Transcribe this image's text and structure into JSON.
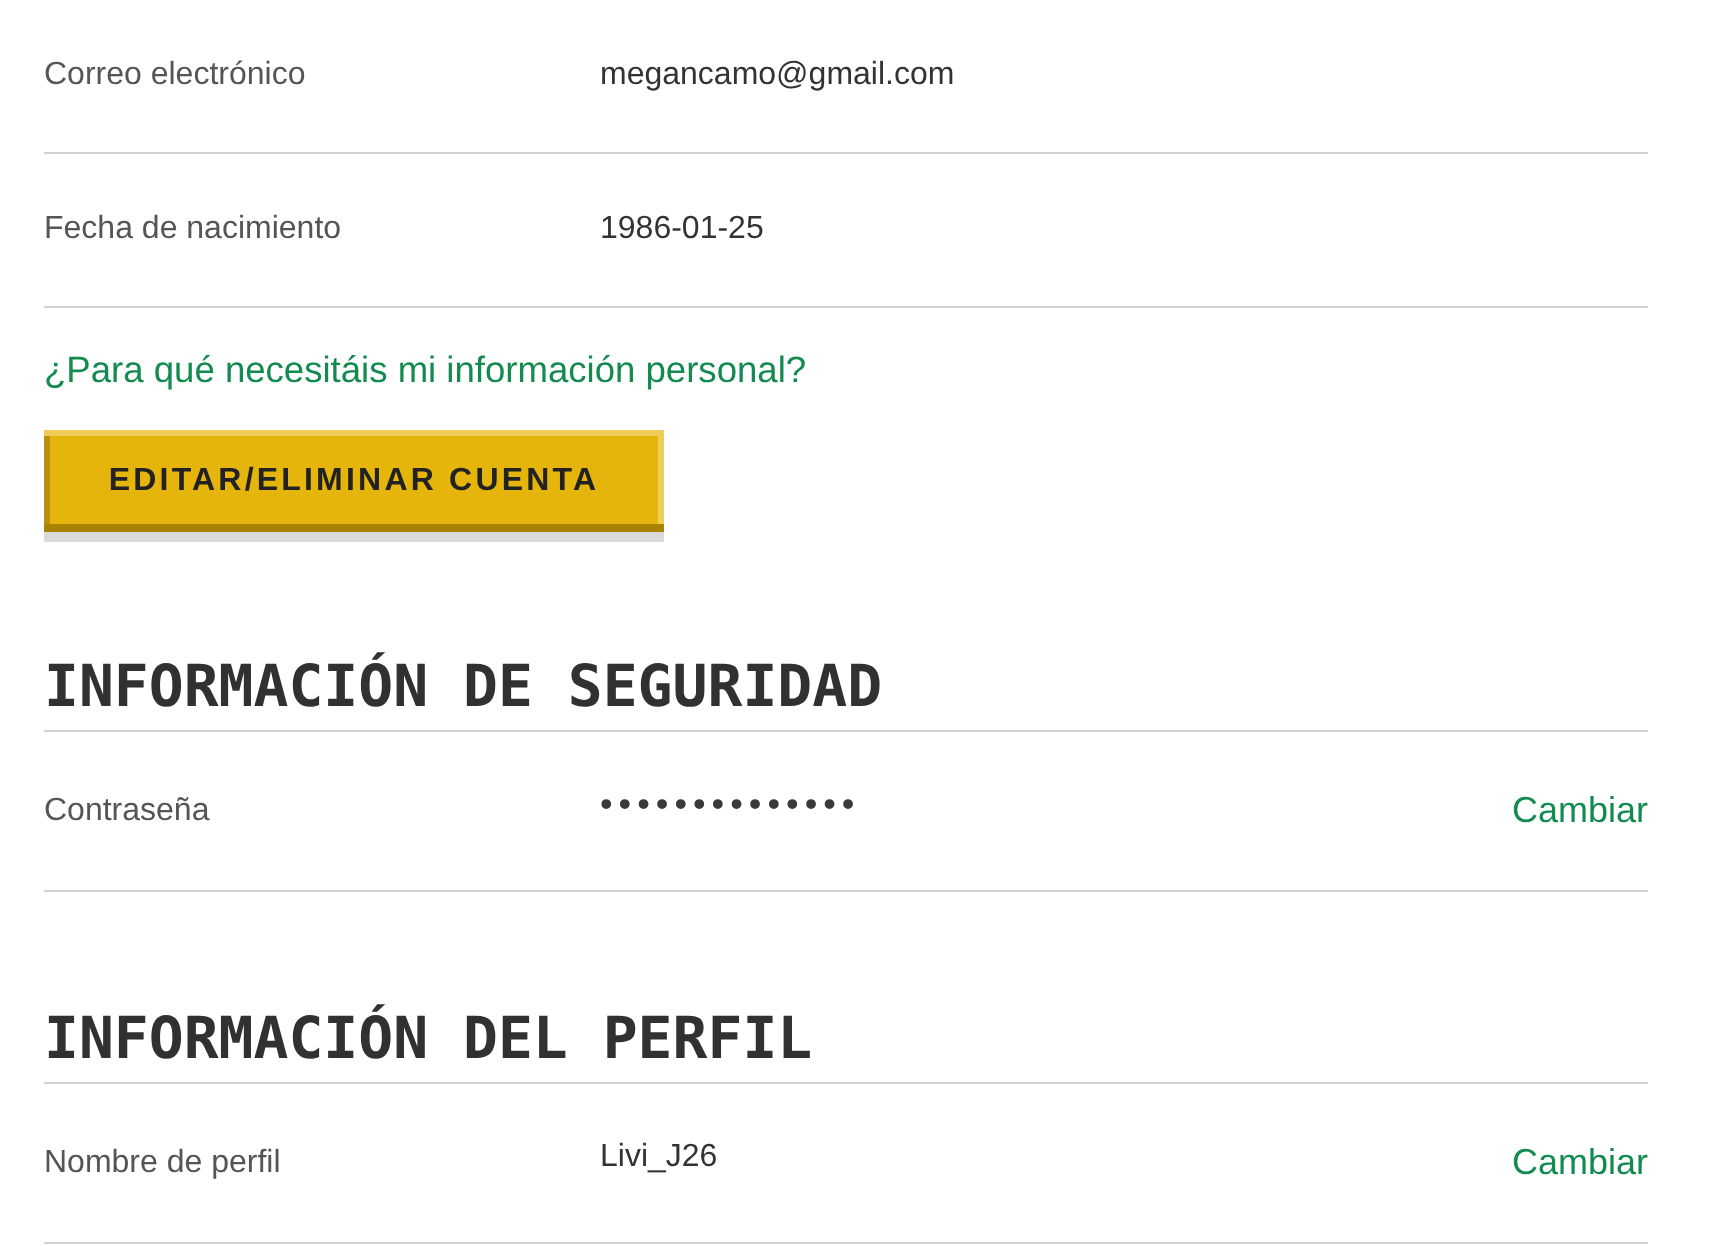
{
  "personal_rows": [
    {
      "label": "Correo electrónico",
      "value": "megancamo@gmail.com"
    },
    {
      "label": "Fecha de nacimiento",
      "value": "1986-01-25"
    }
  ],
  "info_link": "¿Para qué necesitáis mi información personal?",
  "edit_button": "EDITAR/ELIMINAR CUENTA",
  "sections": [
    {
      "title": "INFORMACIÓN DE SEGURIDAD",
      "rows": [
        {
          "label": "Contraseña",
          "value": "••••••••••••••",
          "kind": "masked",
          "action": "Cambiar"
        }
      ]
    },
    {
      "title": "INFORMACIÓN DEL PERFIL",
      "rows": [
        {
          "label": "Nombre de perfil",
          "value": "Livi_J26",
          "kind": "text",
          "action": "Cambiar"
        }
      ]
    }
  ]
}
